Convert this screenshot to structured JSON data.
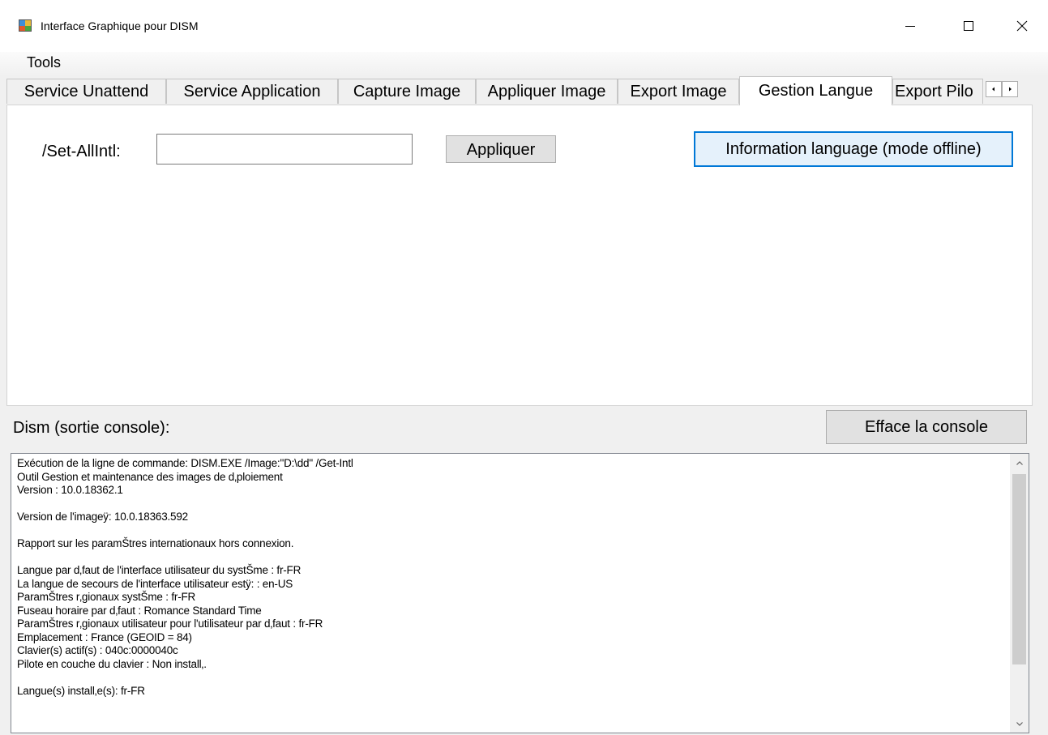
{
  "window": {
    "title": "Interface Graphique pour DISM"
  },
  "menu": {
    "tools": "Tools"
  },
  "tabs": {
    "items": [
      {
        "label": "Service Unattend"
      },
      {
        "label": "Service Application"
      },
      {
        "label": "Capture Image"
      },
      {
        "label": "Appliquer Image"
      },
      {
        "label": "Export Image"
      },
      {
        "label": "Gestion Langue"
      },
      {
        "label": "Export Pilo"
      }
    ],
    "selected": "Gestion Langue"
  },
  "gestion_langue": {
    "set_allintl_label": "/Set-AllIntl:",
    "set_allintl_value": "",
    "apply_button": "Appliquer",
    "info_button": "Information language (mode offline)"
  },
  "console": {
    "label": "Dism (sortie console):",
    "clear_button": "Efface la console",
    "output": "Exécution de la ligne de commande: DISM.EXE /Image:\"D:\\dd\" /Get-Intl\nOutil Gestion et maintenance des images de d‚ploiement\nVersion : 10.0.18362.1\n\nVersion de l'imageÿ: 10.0.18363.592\n\nRapport sur les paramŠtres internationaux hors connexion.\n\nLangue par d‚faut de l'interface utilisateur du systŠme : fr-FR\nLa langue de secours de l'interface utilisateur estÿ: : en-US\nParamŠtres r‚gionaux systŠme : fr-FR\nFuseau horaire par d‚faut : Romance Standard Time\nParamŠtres r‚gionaux utilisateur pour l'utilisateur par d‚faut : fr-FR\nEmplacement : France (GEOID = 84)\nClavier(s) actif(s) : 040c:0000040c\nPilote en couche du clavier : Non install‚.\n\nLangue(s) install‚e(s): fr-FR"
  },
  "colors": {
    "focus_border": "#0078d7",
    "window_background": "#f0f0f0"
  }
}
